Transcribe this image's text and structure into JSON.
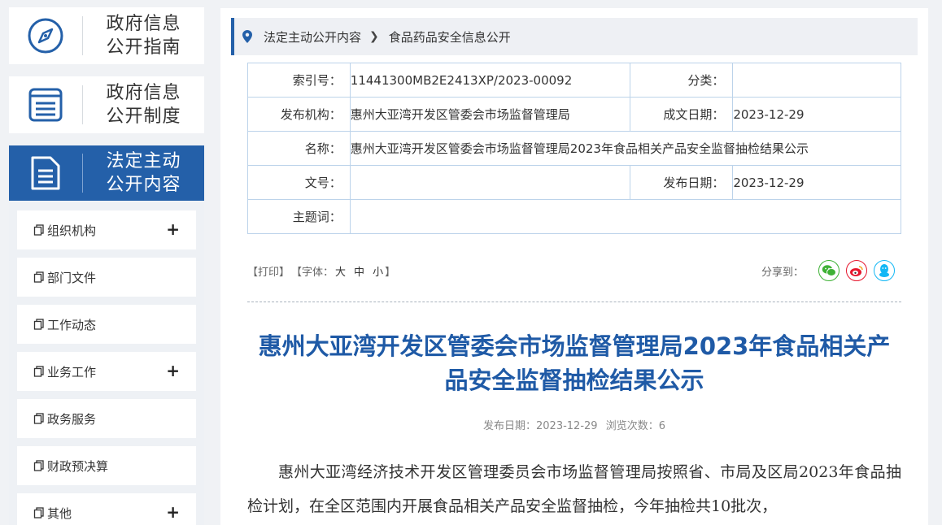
{
  "sidebar": {
    "cards": [
      {
        "line1": "政府信息",
        "line2": "公开指南",
        "icon": "compass-icon"
      },
      {
        "line1": "政府信息",
        "line2": "公开制度",
        "icon": "list-icon"
      },
      {
        "line1": "法定主动",
        "line2": "公开内容",
        "icon": "document-icon"
      }
    ],
    "menu": [
      {
        "label": "组织机构",
        "expand": "+"
      },
      {
        "label": "部门文件",
        "expand": ""
      },
      {
        "label": "工作动态",
        "expand": ""
      },
      {
        "label": "业务工作",
        "expand": "+"
      },
      {
        "label": "政务服务",
        "expand": ""
      },
      {
        "label": "财政预决算",
        "expand": ""
      },
      {
        "label": "其他",
        "expand": "+"
      }
    ]
  },
  "breadcrumb": {
    "parent": "法定主动公开内容",
    "current": "食品药品安全信息公开"
  },
  "meta": {
    "index_label": "索引号：",
    "index_value": "11441300MB2E2413XP/2023-00092",
    "category_label": "分类：",
    "category_value": "",
    "org_label": "发布机构：",
    "org_value": "惠州大亚湾开发区管委会市场监督管理局",
    "written_label": "成文日期：",
    "written_value": "2023-12-29",
    "name_label": "名称：",
    "name_value": "惠州大亚湾开发区管委会市场监督管理局2023年食品相关产品安全监督抽检结果公示",
    "docno_label": "文号：",
    "docno_value": "",
    "pubdate_label": "发布日期：",
    "pubdate_value": "2023-12-29",
    "keyword_label": "主题词："
  },
  "tools": {
    "print": "【打印】",
    "font_prefix": "【字体：",
    "font_large": "大",
    "font_medium": "中",
    "font_small": "小",
    "font_suffix": "】",
    "share_label": "分享到：",
    "wechat_color": "#3eb135",
    "weibo_color": "#e6162d",
    "qq_color": "#12b7f5"
  },
  "article": {
    "title": "惠州大亚湾开发区管委会市场监督管理局2023年食品相关产品安全监督抽检结果公示",
    "pub_date_label": "发布日期：",
    "pub_date": "2023-12-29",
    "views_label": "浏览次数：",
    "views": "6",
    "body": "惠州大亚湾经济技术开发区管理委员会市场监督管理局按照省、市局及区局2023年食品抽检计划，在全区范围内开展食品相关产品安全监督抽检，今年抽检共10批次，"
  },
  "colors": {
    "brand_blue": "#2460a9",
    "title_blue": "#1f5aa6",
    "table_border": "#bcd3ea"
  }
}
